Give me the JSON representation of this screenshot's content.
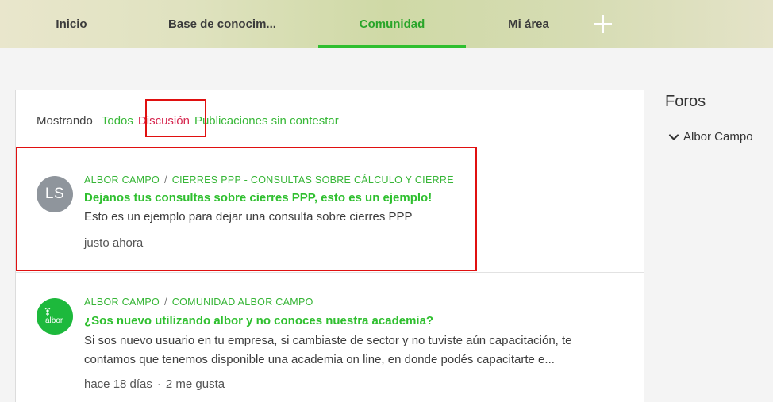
{
  "nav": {
    "tabs": [
      {
        "label": "Inicio"
      },
      {
        "label": "Base de conocim..."
      },
      {
        "label": "Comunidad"
      },
      {
        "label": "Mi área"
      }
    ],
    "active_tab": "Comunidad",
    "accent_color": "#2fbf2f"
  },
  "filter": {
    "label": "Mostrando",
    "options": [
      "Todos",
      "Discusión",
      "Publicaciones sin contestar"
    ],
    "selected": "Discusión"
  },
  "posts": [
    {
      "avatar_initials": "LS",
      "category": "ALBOR CAMPO",
      "subcategory": "CIERRES PPP - CONSULTAS SOBRE CÁLCULO Y CIERRE",
      "title": "Dejanos tus consultas sobre cierres PPP, esto es un ejemplo!",
      "excerpt": "Esto es un ejemplo para dejar una consulta sobre cierres PPP",
      "time": "justo ahora"
    },
    {
      "avatar_logo": "albor",
      "category": "ALBOR CAMPO",
      "subcategory": "COMUNIDAD ALBOR CAMPO",
      "title": "¿Sos nuevo utilizando albor y no conoces nuestra academia?",
      "excerpt": "Si sos nuevo usuario en tu empresa, si cambiaste de sector y no tuviste aún capacitación, te contamos que tenemos disponible una academia on line, en donde podés capacitarte e...",
      "time": "hace 18 días",
      "likes": "2 me gusta"
    }
  ],
  "sidebar": {
    "title": "Foros",
    "items": [
      {
        "label": "Albor Campo",
        "icon": "chevron-down-icon"
      }
    ]
  },
  "colors": {
    "link_green": "#38b838",
    "selected_red": "#d6274f",
    "annotation_red": "#e01010"
  }
}
